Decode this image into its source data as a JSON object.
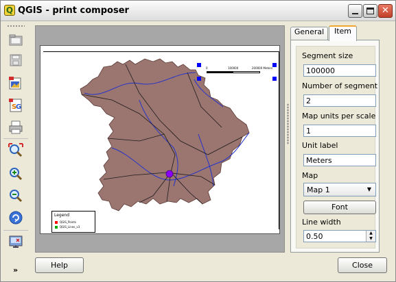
{
  "window": {
    "title": "QGIS - print composer",
    "app_icon": "Q"
  },
  "toolbar": {
    "tools": [
      {
        "name": "open-template-icon"
      },
      {
        "name": "save-template-icon"
      },
      {
        "name": "export-image-icon"
      },
      {
        "name": "export-svg-icon"
      },
      {
        "name": "print-icon"
      },
      {
        "name": "zoom-full-icon"
      },
      {
        "name": "zoom-in-icon"
      },
      {
        "name": "zoom-out-icon"
      },
      {
        "name": "refresh-icon"
      },
      {
        "name": "close-composer-icon"
      }
    ],
    "more": "»"
  },
  "map": {
    "legend_title": "Legend",
    "legend_items": [
      "QGIS_Points",
      "QGIS_Lines_v3"
    ],
    "legend_colors": [
      "#ff0000",
      "#00aa00"
    ],
    "scale_labels": [
      "0",
      "100000",
      "200000 Meters"
    ],
    "colors": {
      "land": "#9b7570",
      "rivers": "#2233cc",
      "roads": "#000000",
      "city": "#8a00ff"
    }
  },
  "tabs": {
    "general": "General",
    "item": "Item"
  },
  "item": {
    "segment_size_label": "Segment size",
    "segment_size": "100000",
    "num_segments_label": "Number of segments",
    "num_segments": "2",
    "map_units_label": "Map units per scalebar u",
    "map_units": "1",
    "unit_label_label": "Unit label",
    "unit_label": "Meters",
    "map_label": "Map",
    "map_value": "Map 1",
    "font_button": "Font",
    "line_width_label": "Line width",
    "line_width": "0.50"
  },
  "buttons": {
    "help": "Help",
    "close": "Close"
  }
}
